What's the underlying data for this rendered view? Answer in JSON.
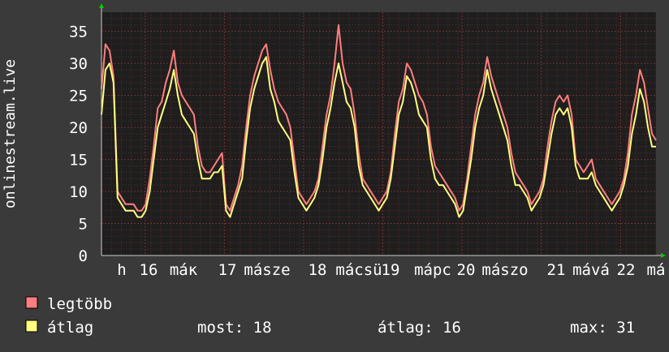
{
  "chart_data": {
    "type": "line",
    "ylabel": "onlinestream.live",
    "ylim": [
      0,
      38
    ],
    "yticks": [
      0,
      5,
      10,
      15,
      20,
      25,
      30,
      35
    ],
    "x_tick_labels": [
      "h",
      "16",
      "máк",
      "17",
      "másze",
      "18",
      "mácsü",
      "19",
      "mápc",
      "20",
      "mászo",
      "21",
      "mává",
      "22",
      "má"
    ],
    "series": [
      {
        "name": "legtöbb",
        "color": "#ff7f7f",
        "values": [
          26,
          33,
          32,
          28,
          10,
          9,
          8,
          8,
          8,
          7,
          7,
          8,
          12,
          17,
          23,
          24,
          27,
          29,
          32,
          27,
          25,
          24,
          23,
          22,
          17,
          14,
          13,
          13,
          14,
          15,
          16,
          8,
          7,
          9,
          11,
          14,
          20,
          25,
          28,
          30,
          32,
          33,
          29,
          26,
          24,
          23,
          22,
          20,
          15,
          10,
          9,
          8,
          9,
          10,
          12,
          17,
          22,
          25,
          30,
          36,
          30,
          27,
          26,
          22,
          16,
          12,
          11,
          10,
          9,
          8,
          9,
          10,
          13,
          19,
          24,
          26,
          30,
          29,
          27,
          25,
          24,
          22,
          17,
          14,
          13,
          12,
          11,
          10,
          9,
          7,
          8,
          12,
          17,
          22,
          25,
          27,
          31,
          28,
          26,
          24,
          22,
          20,
          16,
          13,
          12,
          11,
          10,
          8,
          9,
          10,
          12,
          17,
          21,
          24,
          25,
          24,
          25,
          22,
          15,
          14,
          13,
          14,
          15,
          12,
          11,
          10,
          9,
          8,
          9,
          10,
          12,
          16,
          22,
          25,
          29,
          27,
          23,
          19,
          18
        ]
      },
      {
        "name": "átlag",
        "color": "#ffff7f",
        "values": [
          22,
          29,
          30,
          27,
          9,
          8,
          7,
          7,
          7,
          6,
          6,
          7,
          10,
          15,
          20,
          22,
          24,
          26,
          29,
          25,
          22,
          21,
          20,
          19,
          15,
          12,
          12,
          12,
          13,
          13,
          14,
          7,
          6,
          8,
          10,
          12,
          18,
          23,
          26,
          28,
          30,
          31,
          26,
          24,
          21,
          20,
          19,
          18,
          13,
          9,
          8,
          7,
          8,
          9,
          11,
          15,
          20,
          23,
          27,
          30,
          27,
          24,
          23,
          20,
          14,
          11,
          10,
          9,
          8,
          7,
          8,
          9,
          12,
          17,
          22,
          24,
          28,
          27,
          25,
          22,
          21,
          20,
          15,
          12,
          11,
          11,
          10,
          9,
          8,
          6,
          7,
          11,
          15,
          20,
          23,
          25,
          29,
          26,
          24,
          22,
          20,
          18,
          14,
          11,
          11,
          10,
          9,
          7,
          8,
          9,
          11,
          15,
          19,
          22,
          23,
          22,
          23,
          20,
          14,
          12,
          12,
          12,
          13,
          11,
          10,
          9,
          8,
          7,
          8,
          9,
          11,
          14,
          19,
          22,
          26,
          24,
          20,
          17,
          17
        ]
      }
    ]
  },
  "legend": {
    "items": [
      {
        "label": "legtöbb",
        "color": "#ff7f7f"
      },
      {
        "label": "átlag",
        "color": "#ffff7f"
      }
    ],
    "stats": {
      "most": "most: 18",
      "atlag": "átlag: 16",
      "max": "max: 31"
    }
  },
  "colors": {
    "background": "#3a3a3a",
    "plot_background": "#1e1e1e",
    "grid_minor": "#5a2a2a",
    "grid_major": "#7a3030",
    "text": "#ffffff",
    "arrow": "#00cc00"
  }
}
